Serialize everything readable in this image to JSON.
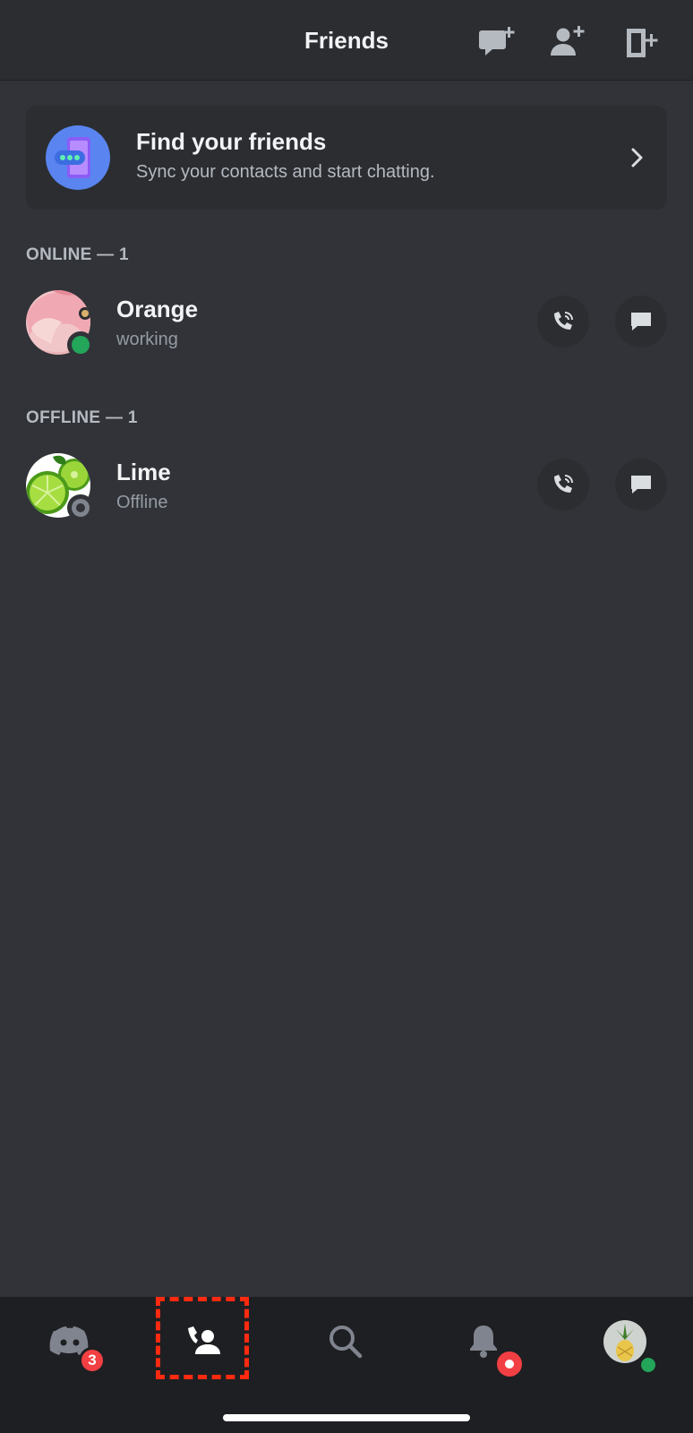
{
  "header": {
    "title": "Friends",
    "icons": [
      "new-message-icon",
      "add-friend-icon",
      "exit-icon"
    ]
  },
  "find_friends": {
    "title": "Find your friends",
    "subtitle": "Sync your contacts and start chatting."
  },
  "sections": {
    "online": {
      "label": "ONLINE — 1",
      "friends": [
        {
          "name": "Orange",
          "status_text": "working",
          "presence": "online"
        }
      ]
    },
    "offline": {
      "label": "OFFLINE — 1",
      "friends": [
        {
          "name": "Lime",
          "status_text": "Offline",
          "presence": "offline"
        }
      ]
    }
  },
  "bottom_nav": {
    "items": [
      {
        "name": "servers",
        "icon": "discord-icon",
        "badge": "3"
      },
      {
        "name": "friends",
        "icon": "friends-icon",
        "active": true
      },
      {
        "name": "search",
        "icon": "search-icon"
      },
      {
        "name": "notifications",
        "icon": "bell-icon",
        "badge_dot": true
      },
      {
        "name": "profile",
        "icon": "avatar",
        "presence": "online"
      }
    ]
  },
  "colors": {
    "background": "#313338",
    "header": "#2b2d31",
    "nav": "#1e1f22",
    "online": "#23a55a",
    "offline": "#80848e",
    "badge": "#f23f43",
    "highlight": "#ff2a10",
    "accent": "#5a84f0"
  }
}
